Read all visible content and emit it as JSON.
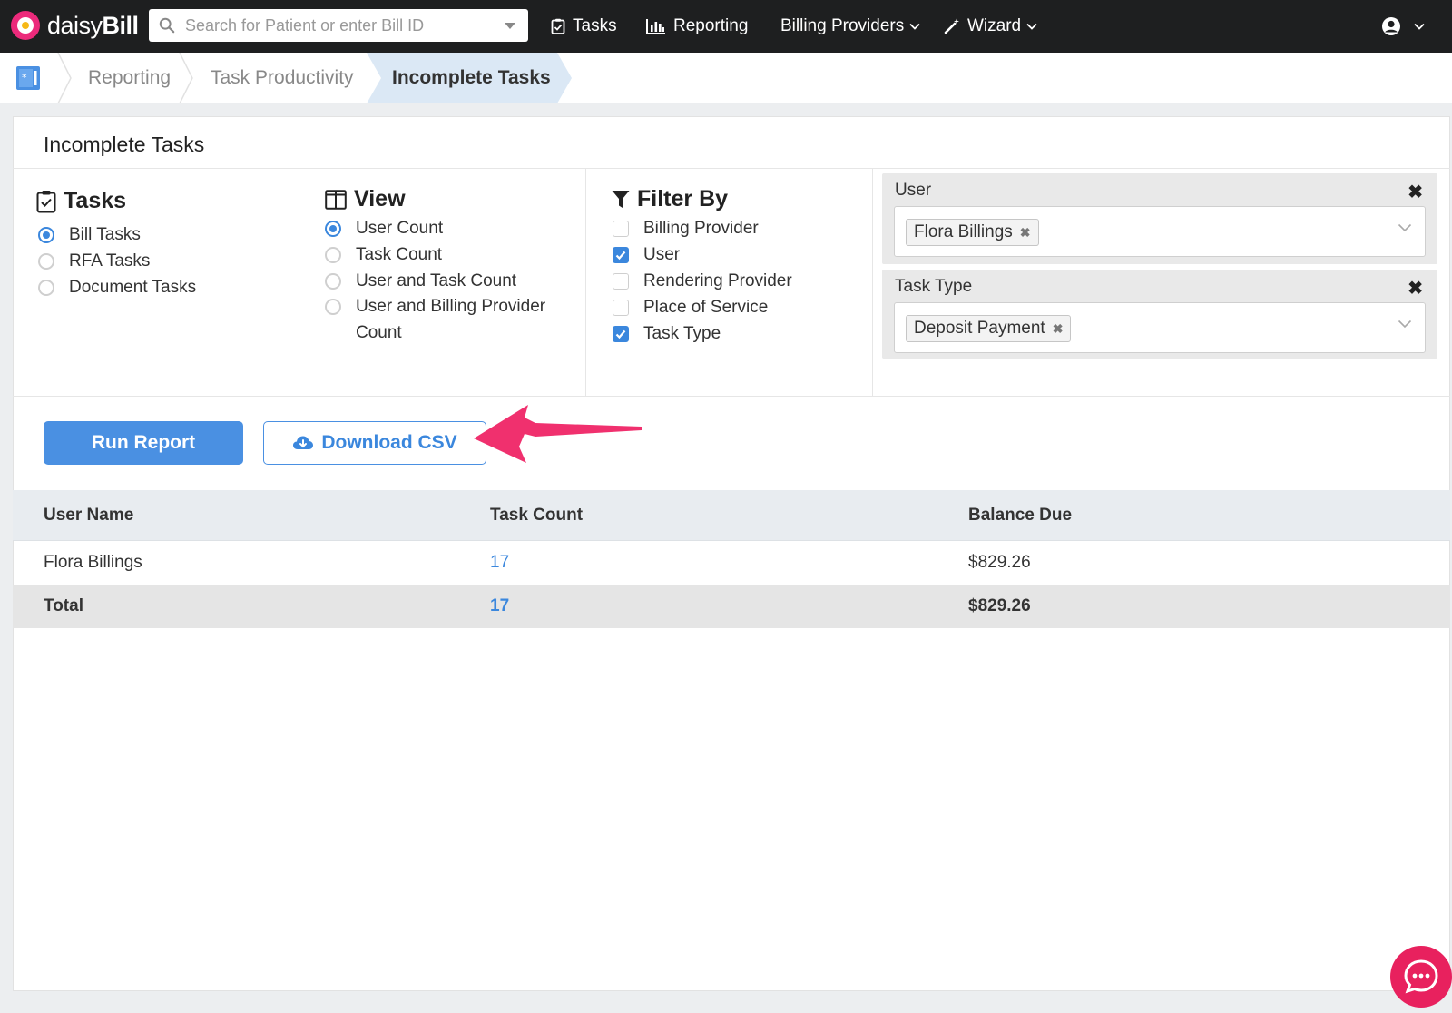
{
  "brand": {
    "name_light": "daisy",
    "name_bold": "Bill"
  },
  "search": {
    "placeholder": "Search for Patient or enter Bill ID"
  },
  "nav": {
    "tasks": "Tasks",
    "reporting": "Reporting",
    "billing_providers": "Billing Providers",
    "wizard": "Wizard"
  },
  "breadcrumb": {
    "items": [
      "Reporting",
      "Task Productivity"
    ],
    "active": "Incomplete Tasks"
  },
  "page": {
    "title": "Incomplete Tasks"
  },
  "tasks": {
    "heading": "Tasks",
    "options": [
      {
        "label": "Bill Tasks",
        "selected": true
      },
      {
        "label": "RFA Tasks",
        "selected": false
      },
      {
        "label": "Document Tasks",
        "selected": false
      }
    ]
  },
  "view": {
    "heading": "View",
    "options": [
      {
        "label": "User Count",
        "selected": true
      },
      {
        "label": "Task Count",
        "selected": false
      },
      {
        "label": "User and Task Count",
        "selected": false
      },
      {
        "label": "User and Billing Provider Count",
        "selected": false
      }
    ]
  },
  "filter_by": {
    "heading": "Filter By",
    "options": [
      {
        "label": "Billing Provider",
        "checked": false
      },
      {
        "label": "User",
        "checked": true
      },
      {
        "label": "Rendering Provider",
        "checked": false
      },
      {
        "label": "Place of Service",
        "checked": false
      },
      {
        "label": "Task Type",
        "checked": true
      }
    ]
  },
  "filters": {
    "user": {
      "label": "User",
      "tag": "Flora Billings"
    },
    "task_type": {
      "label": "Task Type",
      "tag": "Deposit Payment"
    }
  },
  "actions": {
    "run_report": "Run Report",
    "download_csv": "Download CSV"
  },
  "table": {
    "columns": [
      "User Name",
      "Task Count",
      "Balance Due"
    ],
    "rows": [
      {
        "user": "Flora Billings",
        "count": "17",
        "balance": "$829.26"
      }
    ],
    "total": {
      "label": "Total",
      "count": "17",
      "balance": "$829.26"
    }
  },
  "colors": {
    "accent": "#3b87dd",
    "brand_pink": "#ec2a7b",
    "annotation_arrow": "#f0306e",
    "nav_bg": "#1e1f20"
  }
}
